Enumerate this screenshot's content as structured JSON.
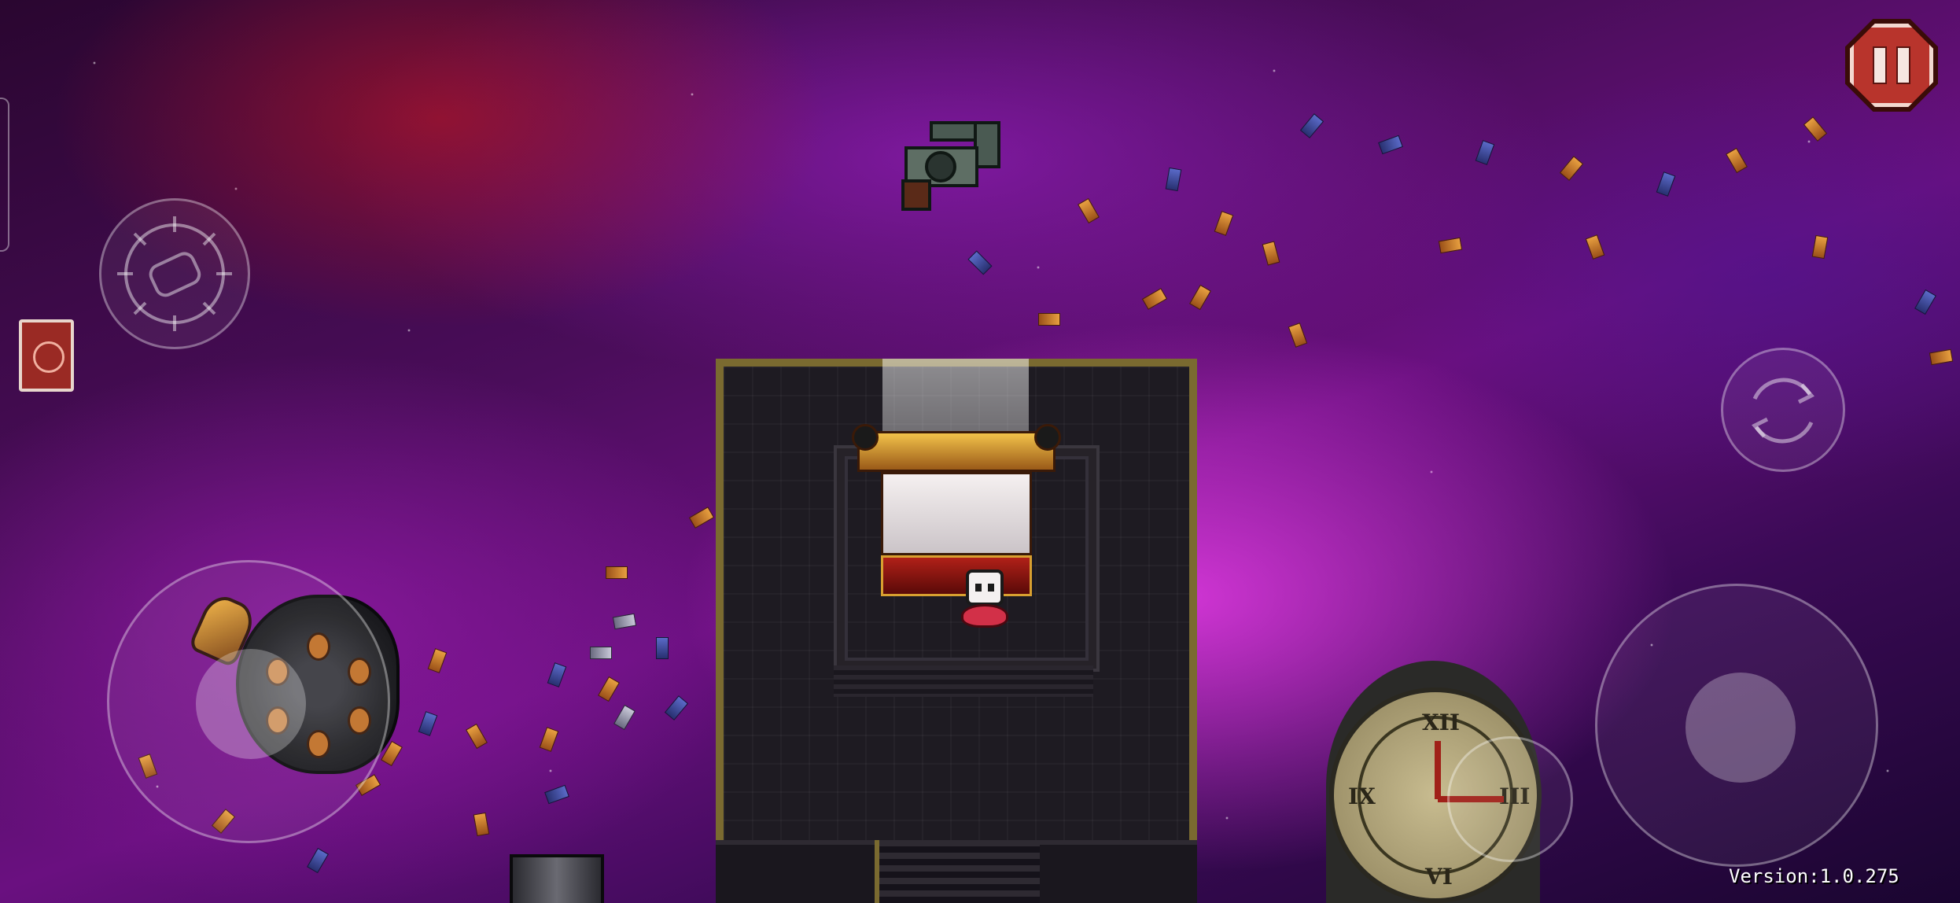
{
  "hud": {
    "version_text": "Version:1.0.275",
    "pause_icon": "pause-icon",
    "blank_icon": "blank-bullet-icon",
    "reload_icon": "reload-icon",
    "book_icon": "ammonomicon-book-icon",
    "left_stick_icon": "move-joystick",
    "right_stick_icon": "aim-joystick",
    "active_item_icon": "active-item-icon"
  },
  "scene": {
    "player_icon": "player-character",
    "shrine_icon": "shrine",
    "revolver_icon": "revolver-gun-icon",
    "ammo_drum_icon": "revolver-cylinder",
    "clock_icon": "clock-icon",
    "clock_numerals": [
      "XII",
      "III",
      "IX",
      "VI"
    ]
  },
  "colors": {
    "pause_bg": "#b8342c",
    "platform_border": "#7a6a30",
    "shrine_gold": "#f2c24a"
  }
}
